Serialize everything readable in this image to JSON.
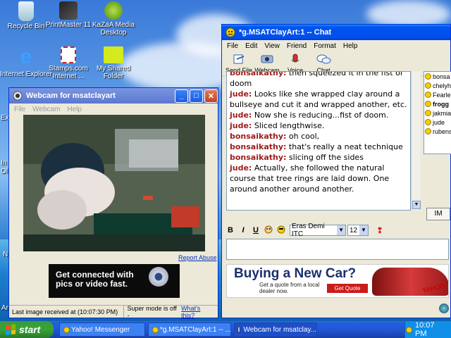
{
  "desktop": {
    "icons": [
      {
        "label": "Recycle Bin",
        "icon": "recycle-bin-icon"
      },
      {
        "label": "PrintMaster 11",
        "icon": "printmaster-icon"
      },
      {
        "label": "KaZaA Media Desktop",
        "icon": "kazaa-icon"
      },
      {
        "label": "Internet Explorer",
        "icon": "ie-icon"
      },
      {
        "label": "Stamps.com Internet ...",
        "icon": "stamps-icon"
      },
      {
        "label": "My Shared Folder",
        "icon": "shared-folder-icon"
      }
    ],
    "partial_labels": [
      "Ex",
      "In",
      "Ol",
      "N",
      "Ar"
    ]
  },
  "webcam_window": {
    "title": "Webcam for msatclayart",
    "menu": [
      "File",
      "Webcam",
      "Help"
    ],
    "report_abuse": "Report Abuse",
    "ad_text": "Get connected with pics or video fast.",
    "status_left": "Last image received at (10:07:30 PM)",
    "status_right_prefix": "Super mode is off - ",
    "status_right_link": "What's this?"
  },
  "chat_window": {
    "title": "*g.MSATClayArt:1 -- Chat",
    "menu": [
      "File",
      "Edit",
      "View",
      "Friend",
      "Format",
      "Help"
    ],
    "toolbar": [
      "Send File",
      "Webcam",
      "Voice",
      "Chat"
    ],
    "messages": [
      {
        "user": "bonsaikathy:",
        "text": " then squeezed it in the fist of doom"
      },
      {
        "user": "jude:",
        "text": " Looks like she wrapped clay around a bullseye and cut it and wrapped another, etc."
      },
      {
        "user": "jude:",
        "text": " Now she is reducing...fist of doom."
      },
      {
        "user": "jude:",
        "text": " Sliced lengthwise."
      },
      {
        "user": "bonsaikathy:",
        "text": " oh cool,"
      },
      {
        "user": "bonsaikathy:",
        "text": " that's really a neat technique"
      },
      {
        "user": "bonsaikathy:",
        "text": " slicing off the sides"
      },
      {
        "user": "jude:",
        "text": " Actually, she followed the natural course that tree rings are laid down. One around another around another."
      }
    ],
    "users": [
      "bonsa",
      "chelyh",
      "Fearle",
      "frogg",
      "jakmia",
      "jude",
      "rubens"
    ],
    "im_button": "IM",
    "format": {
      "bold": "B",
      "italic": "I",
      "underline": "U",
      "font": "Eras Demi ITC",
      "size": "12"
    },
    "ad": {
      "headline": "Buying a New Car?",
      "sub": "Get a quote from a local dealer now.",
      "button": "Get Quote",
      "brand": "YAHOO!"
    }
  },
  "taskbar": {
    "start": "start",
    "tasks": [
      "Yahoo! Messenger",
      "*g.MSATClayArt:1 -- ...",
      "Webcam for msatclay..."
    ],
    "clock": "10:07 PM"
  },
  "colors": {
    "accent": "#0053ee",
    "chat_user": "#9e1b1b",
    "start_green": "#36a336"
  }
}
